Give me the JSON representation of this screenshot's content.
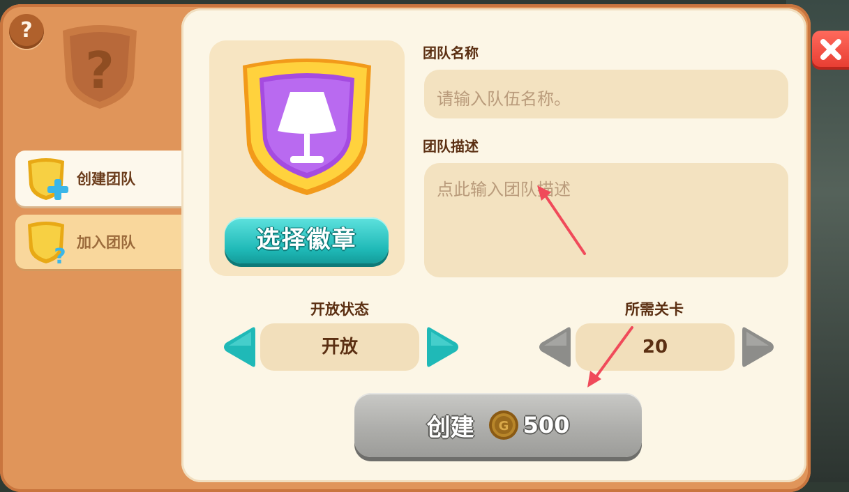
{
  "help_icon": "?",
  "tabs": [
    {
      "label": "创建团队",
      "icon": "shield-plus-icon",
      "active": true
    },
    {
      "label": "加入团队",
      "icon": "shield-question-icon",
      "active": false
    }
  ],
  "badge": {
    "icon": "lamp-icon",
    "choose_label": "选择徽章"
  },
  "team_name": {
    "label": "团队名称",
    "placeholder": "请输入队伍名称。"
  },
  "team_desc": {
    "label": "团队描述",
    "placeholder": "点此输入团队描述"
  },
  "open_status": {
    "label": "开放状态",
    "value": "开放"
  },
  "required_level": {
    "label": "所需关卡",
    "value": "20"
  },
  "create_button": {
    "label": "创建",
    "cost": "500",
    "currency_icon": "gold-coin-icon"
  },
  "colors": {
    "accent_teal": "#1fb9b7",
    "frame_orange": "#e0955a",
    "panel_cream": "#fcf6e6",
    "disabled_gray": "#aeaeab",
    "close_red": "#e63b30"
  }
}
